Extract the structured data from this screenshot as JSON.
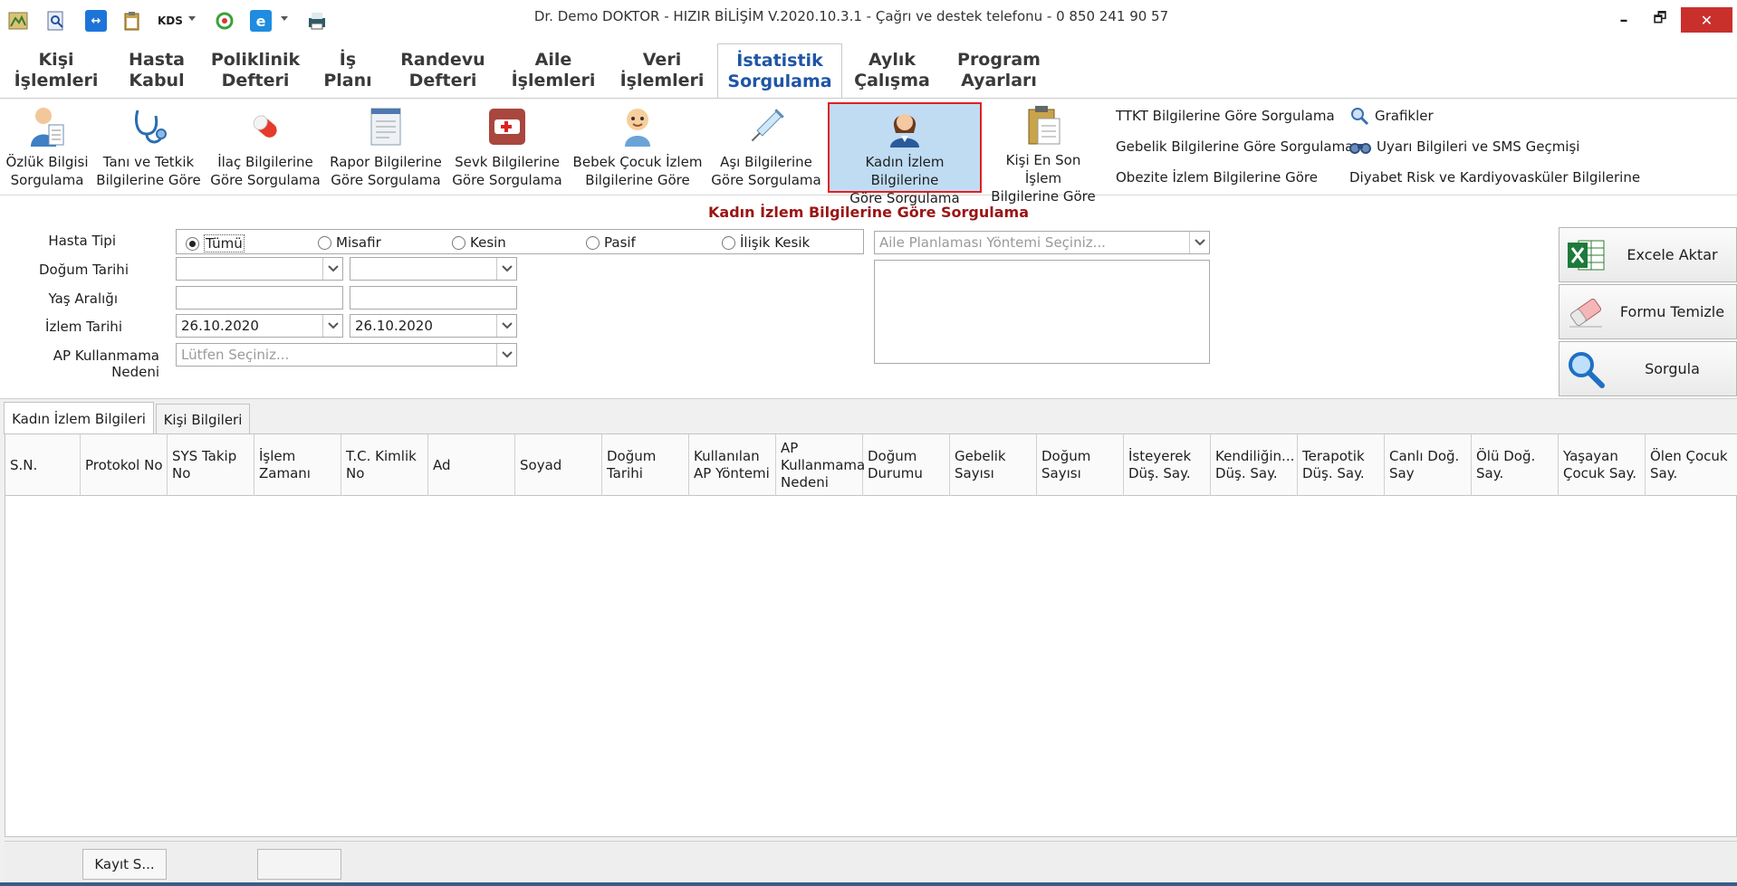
{
  "window": {
    "title": "Dr. Demo DOKTOR - HIZIR BİLİŞİM V.2020.10.3.1 - Çağrı ve destek telefonu - 0 850 241 90 57",
    "quick_access_kds_label": "KDS",
    "minimize_symbol": "–",
    "restore_symbol": "🗗",
    "close_symbol": "✕"
  },
  "menu": {
    "tabs": [
      {
        "label": "Kişi\nİşlemleri"
      },
      {
        "label": "Hasta\nKabul"
      },
      {
        "label": "Poliklinik\nDefteri"
      },
      {
        "label": "İş\nPlanı"
      },
      {
        "label": "Randevu\nDefteri"
      },
      {
        "label": "Aile\nİşlemleri"
      },
      {
        "label": "Veri\nİşlemleri"
      },
      {
        "label": "İstatistik\nSorgulama"
      },
      {
        "label": "Aylık\nÇalışma"
      },
      {
        "label": "Program\nAyarları"
      }
    ]
  },
  "ribbon": {
    "buttons": [
      {
        "label": "Özlük Bilgisi\nSorgulama",
        "icon": "person-id-icon"
      },
      {
        "label": "Tanı ve Tetkik\nBilgilerine Göre",
        "icon": "stethoscope-icon"
      },
      {
        "label": "İlaç Bilgilerine\nGöre Sorgulama",
        "icon": "pill-icon"
      },
      {
        "label": "Rapor Bilgilerine\nGöre Sorgulama",
        "icon": "report-icon"
      },
      {
        "label": "Sevk Bilgilerine\nGöre Sorgulama",
        "icon": "ambulance-icon"
      },
      {
        "label": "Bebek Çocuk İzlem\nBilgilerine Göre",
        "icon": "baby-icon"
      },
      {
        "label": "Aşı Bilgilerine\nGöre Sorgulama",
        "icon": "syringe-icon"
      },
      {
        "label": "Kadın İzlem Bilgilerine\nGöre Sorgulama",
        "icon": "woman-icon"
      },
      {
        "label": "Kişi En Son İşlem\nBilgilerine Göre",
        "icon": "clipboard-icon"
      }
    ],
    "links_col1": [
      "TTKT Bilgilerine Göre Sorgulama",
      "Gebelik Bilgilerine Göre Sorgulama",
      "Obezite İzlem Bilgilerine Göre"
    ],
    "links_col2": [
      "Grafikler",
      "Uyarı Bilgileri ve SMS Geçmişi",
      "Diyabet Risk ve Kardiyovasküler Bilgilerine"
    ]
  },
  "form": {
    "title": "Kadın İzlem Bilgilerine Göre Sorgulama",
    "labels": {
      "hasta_tipi": "Hasta Tipi",
      "dogum_tarihi": "Doğum Tarihi",
      "yas_araligi": "Yaş Aralığı",
      "izlem_tarihi": "İzlem Tarihi",
      "ap_nedeni": "AP Kullanmama Nedeni"
    },
    "radios": [
      "Tümü",
      "Misafir",
      "Kesin",
      "Pasif",
      "İlişik Kesik"
    ],
    "radio_selected": "Tümü",
    "izlem_start": "26.10.2020",
    "izlem_end": "26.10.2020",
    "ap_nedeni_placeholder": "Lütfen Seçiniz...",
    "ap_yontemi_placeholder": "Aile Planlaması Yöntemi Seçiniz..."
  },
  "actions": {
    "excel": "Excele Aktar",
    "clear": "Formu Temizle",
    "query": "Sorgula"
  },
  "lower_tabs": [
    "Kadın İzlem Bilgileri",
    "Kişi Bilgileri"
  ],
  "grid": {
    "columns": [
      "S.N.",
      "Protokol No",
      "SYS Takip\nNo",
      "İşlem\nZamanı",
      "T.C. Kimlik\nNo",
      "Ad",
      "Soyad",
      "Doğum\nTarihi",
      "Kullanılan\nAP Yöntemi",
      "AP\nKullanmama\nNedeni",
      "Doğum\nDurumu",
      "Gebelik\nSayısı",
      "Doğum\nSayısı",
      "İsteyerek\nDüş. Say.",
      "Kendiliğin...\nDüş. Say.",
      "Terapotik\nDüş. Say.",
      "Canlı Doğ.\nSay",
      "Ölü Doğ.\nSay.",
      "Yaşayan\nÇocuk Say.",
      "Ölen Çocuk\nSay."
    ]
  },
  "footer": {
    "record_button": "Kayıt S..."
  }
}
